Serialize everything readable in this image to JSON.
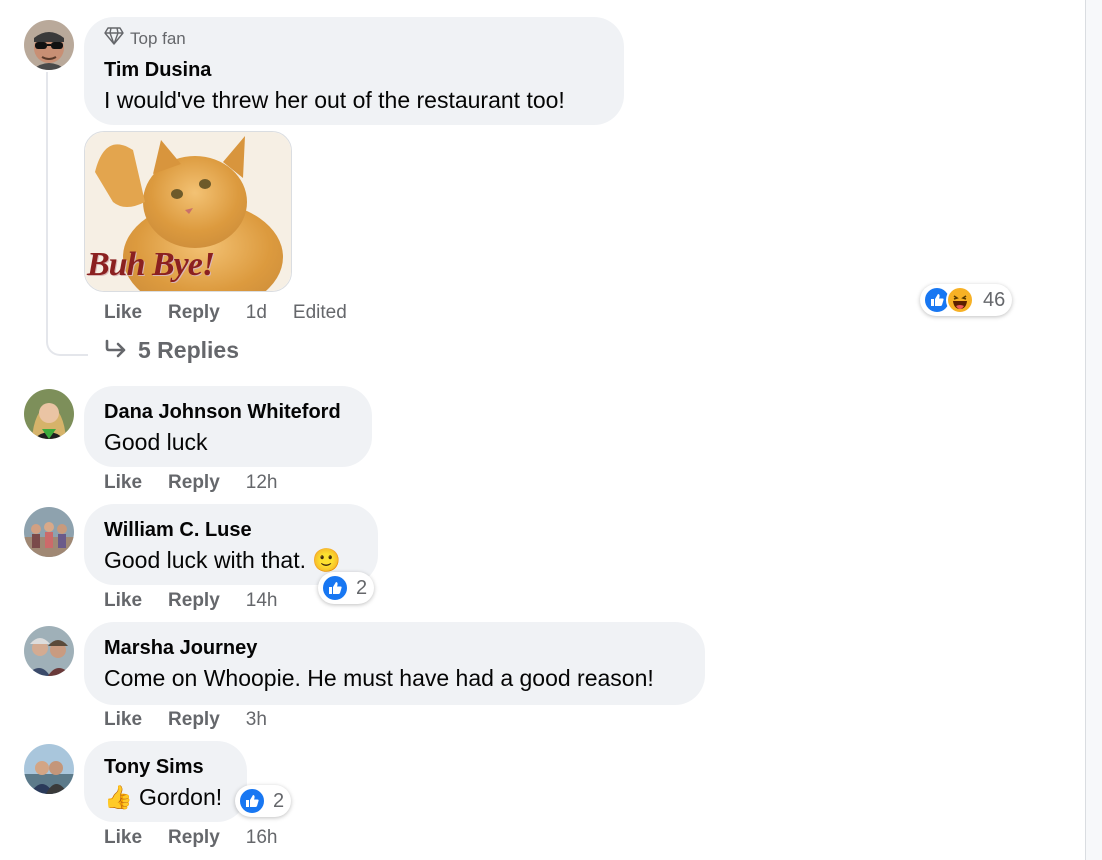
{
  "comments": [
    {
      "badge": "Top fan",
      "author": "Tim Dusina",
      "text": "I would've threw her out of the restaurant too!",
      "gif_caption": "Buh Bye!",
      "actions": {
        "like": "Like",
        "reply": "Reply",
        "time": "1d",
        "edited": "Edited"
      },
      "reactions": {
        "icons": [
          "like-icon",
          "haha-icon"
        ],
        "count": "46"
      },
      "replies_link": "5 Replies"
    },
    {
      "author": "Dana Johnson Whiteford",
      "text": "Good luck",
      "actions": {
        "like": "Like",
        "reply": "Reply",
        "time": "12h"
      }
    },
    {
      "author": "William C. Luse",
      "text": "Good luck with that.",
      "emoji": "🙂",
      "actions": {
        "like": "Like",
        "reply": "Reply",
        "time": "14h"
      },
      "reactions": {
        "icons": [
          "like-icon"
        ],
        "count": "2"
      }
    },
    {
      "author": "Marsha Journey",
      "text": "Come on Whoopie. He must have had a good reason!",
      "actions": {
        "like": "Like",
        "reply": "Reply",
        "time": "3h"
      }
    },
    {
      "author": "Tony Sims",
      "emoji": "👍",
      "text": "Gordon!",
      "actions": {
        "like": "Like",
        "reply": "Reply",
        "time": "16h"
      },
      "reactions": {
        "icons": [
          "like-icon"
        ],
        "count": "2"
      }
    }
  ],
  "colors": {
    "bubble": "#f0f2f5",
    "meta_text": "#65676b",
    "like_blue": "#1877f2",
    "haha_yellow": "#f7b125"
  }
}
